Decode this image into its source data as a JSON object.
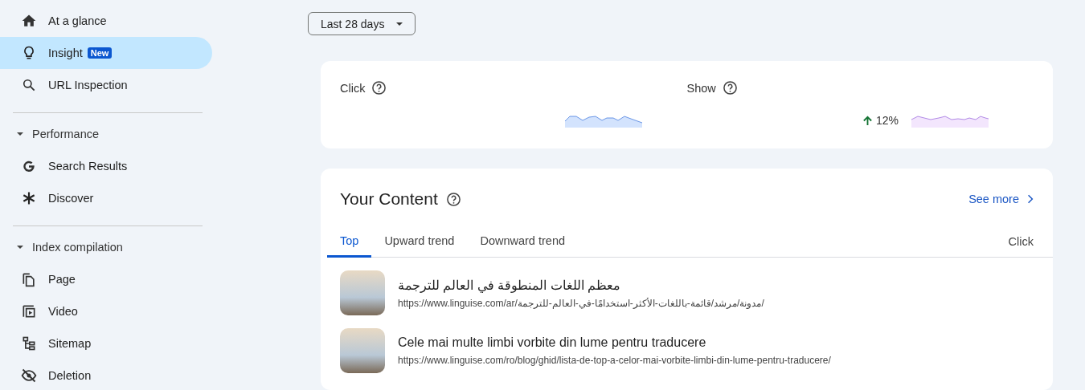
{
  "date_range": {
    "label": "Last 28 days"
  },
  "sidebar": {
    "groups": [
      {
        "items": [
          {
            "label": "At a glance",
            "selected": false
          },
          {
            "label": "Insight",
            "selected": true,
            "badge": "New"
          },
          {
            "label": "URL Inspection",
            "selected": false
          }
        ]
      },
      {
        "title": "Performance",
        "expanded": true,
        "items": [
          {
            "label": "Search Results",
            "selected": false
          },
          {
            "label": "Discover",
            "selected": false
          }
        ]
      },
      {
        "title": "Index compilation",
        "expanded": true,
        "items": [
          {
            "label": "Page",
            "selected": false
          },
          {
            "label": "Video",
            "selected": false
          },
          {
            "label": "Sitemap",
            "selected": false
          },
          {
            "label": "Deletion",
            "selected": false
          }
        ]
      }
    ]
  },
  "metrics": [
    {
      "label": "Click"
    },
    {
      "label": "Show",
      "change": "12%",
      "rising": true
    }
  ],
  "content": {
    "title": "Your Content",
    "see_more": "See more",
    "tabs": [
      {
        "label": "Top",
        "selected": true
      },
      {
        "label": "Upward trend",
        "selected": false
      },
      {
        "label": "Downward trend",
        "selected": false
      }
    ],
    "column": "Click",
    "rows": [
      {
        "title": "معظم اللغات المنطوقة في العالم للترجمة",
        "url": "https://www.linguise.com/ar/مدونة/مرشد/قائمة-باللغات-الأكثر-استخدامًا-في-العالم-للترجمة/"
      },
      {
        "title": "Cele mai multe limbi vorbite din lume pentru traducere",
        "url": "https://www.linguise.com/ro/blog/ghid/lista-de-top-a-celor-mai-vorbite-limbi-din-lume-pentru-traducere/"
      }
    ]
  }
}
